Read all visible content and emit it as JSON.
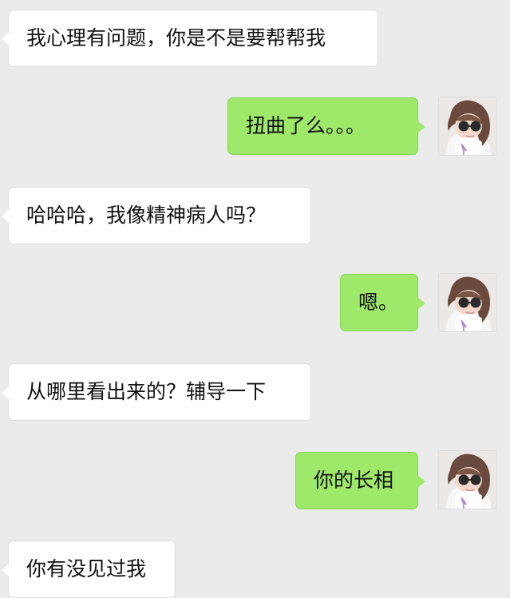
{
  "chat": {
    "messages": [
      {
        "text": "我心理有问题，你是不是要帮帮我"
      },
      {
        "text": "扭曲了么。。。"
      },
      {
        "text": "哈哈哈，我像精神病人吗？"
      },
      {
        "text": "嗯。"
      },
      {
        "text": "从哪里看出来的？辅导一下"
      },
      {
        "text": "你的长相"
      },
      {
        "text": "你有没见过我"
      }
    ]
  },
  "colors": {
    "background": "#ebebeb",
    "incoming_bubble": "#ffffff",
    "outgoing_bubble": "#9ee86a"
  },
  "icons": {
    "avatar": "user-avatar-icon"
  }
}
